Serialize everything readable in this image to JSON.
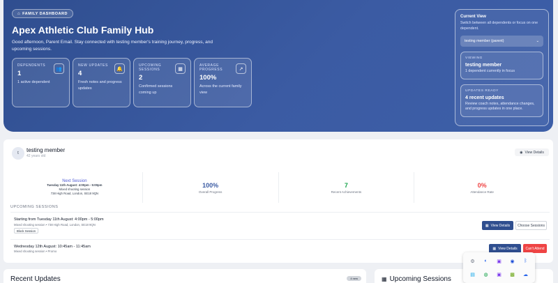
{
  "hero": {
    "tag": "FAMILY DASHBOARD",
    "title": "Apex Athletic Club Family Hub",
    "subtitle": "Good afternoon, Parent Email. Stay connected with testing member's training journey, progress, and upcoming sessions.",
    "stats": [
      {
        "label": "DEPENDENTS",
        "value": "1",
        "desc": "1 active dependent",
        "icon": "users-icon"
      },
      {
        "label": "NEW UPDATES",
        "value": "4",
        "desc": "Fresh notes and progress updates",
        "icon": "bell-icon"
      },
      {
        "label": "UPCOMING SESSIONS",
        "value": "2",
        "desc": "Confirmed sessions coming up",
        "icon": "calendar-icon"
      },
      {
        "label": "AVERAGE PROGRESS",
        "value": "100%",
        "desc": "Across the current family view",
        "icon": "trend-icon"
      }
    ]
  },
  "current_view": {
    "title": "Current View",
    "subtitle": "Switch between all dependents or focus on one dependent.",
    "selected": "testing member (parent)",
    "viewing": {
      "label": "VIEWING",
      "title": "testing member",
      "desc": "1 dependent currently in focus"
    },
    "updates": {
      "label": "UPDATES READY",
      "title": "4 recent updates",
      "desc": "Review coach notes, attendance changes, and progress updates in one place."
    }
  },
  "member": {
    "initial": "t",
    "name": "testing member",
    "age": "42 years old",
    "view_details": "View Details",
    "next_session": {
      "title": "Next Session",
      "date": "Tuesday 11th August: 4:00pm - 5:00pm",
      "type": "Mixed shooting session",
      "location": "738 High Road, London, SE18 9QN"
    },
    "metrics": [
      {
        "value": "100%",
        "label": "Overall Progress",
        "color": "#3b5ba3"
      },
      {
        "value": "7",
        "label": "Recent Achievements",
        "color": "#16a34a"
      },
      {
        "value": "0%",
        "label": "Attendance Rate",
        "color": "#ef4444"
      }
    ],
    "upcoming_label": "UPCOMING SESSIONS",
    "sessions": [
      {
        "title": "Starting from Tuesday 11th August: 4:00pm - 5:00pm",
        "location": "Mixed shooting session • 738 High Road, London, SE18 9QN",
        "badge": "Block Session",
        "btn1": "View Details",
        "btn2": "Choose Sessions"
      },
      {
        "title": "Wednesday 12th August: 10:45am - 11:45am",
        "location": "Mixed shooting session • Promo",
        "btn1": "View Details",
        "btn2": "Can't Attend"
      }
    ]
  },
  "bottom": {
    "recent_updates": "Recent Updates",
    "recent_badge": "4 new",
    "upcoming_sessions": "Upcoming Sessions"
  },
  "tray": {
    "icons": [
      "settings-icon",
      "edge-icon",
      "onenote-icon",
      "outlook-icon",
      "bluetooth-icon",
      "photos-icon",
      "xbox-icon",
      "onenote2-icon",
      "nvidia-icon",
      "onedrive-icon"
    ],
    "glyphs": [
      "⚙",
      "◐",
      "▣",
      "◉",
      "ᛒ",
      "▤",
      "◍",
      "▣",
      "▩",
      "☁"
    ],
    "colors": [
      "#6b7280",
      "#2563eb",
      "#7c3aed",
      "#1d4ed8",
      "#2563eb",
      "#0ea5e9",
      "#16a34a",
      "#7c3aed",
      "#65a30d",
      "#2563eb"
    ]
  }
}
